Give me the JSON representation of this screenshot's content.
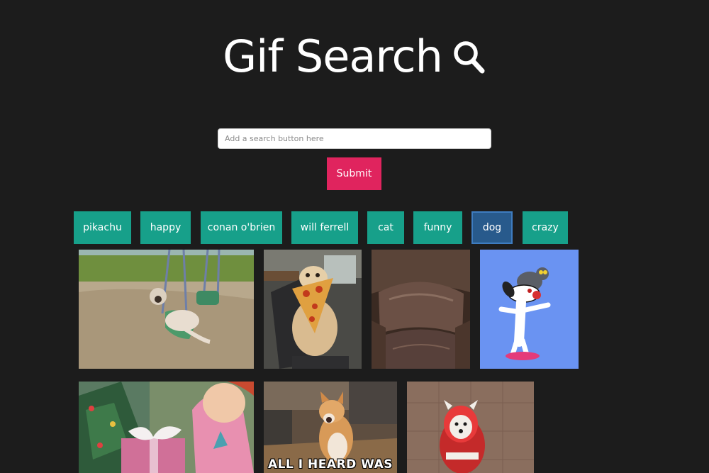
{
  "header": {
    "title": "Gif Search",
    "title_icon": "search-icon"
  },
  "search": {
    "placeholder": "Add a search button here",
    "value": "",
    "submit_label": "Submit"
  },
  "tags": [
    {
      "label": "pikachu",
      "active": false
    },
    {
      "label": "happy",
      "active": false
    },
    {
      "label": "conan o'brien",
      "active": false
    },
    {
      "label": "will ferrell",
      "active": false
    },
    {
      "label": "cat",
      "active": false
    },
    {
      "label": "funny",
      "active": false
    },
    {
      "label": "dog",
      "active": true
    },
    {
      "label": "crazy",
      "active": false
    }
  ],
  "gifs": [
    {
      "subject": "pug-on-swing"
    },
    {
      "subject": "dog-with-pizza"
    },
    {
      "subject": "leather-chair"
    },
    {
      "subject": "cartoon-dog-with-cat"
    },
    {
      "subject": "cartoon-christmas-present"
    },
    {
      "subject": "shiba-dog",
      "caption": "ALL I HEARD WAS"
    },
    {
      "subject": "dog-in-costume"
    }
  ],
  "colors": {
    "background": "#1c1c1c",
    "submit": "#e0245e",
    "tag": "#17a08a",
    "tag_active": "#285a8c"
  }
}
